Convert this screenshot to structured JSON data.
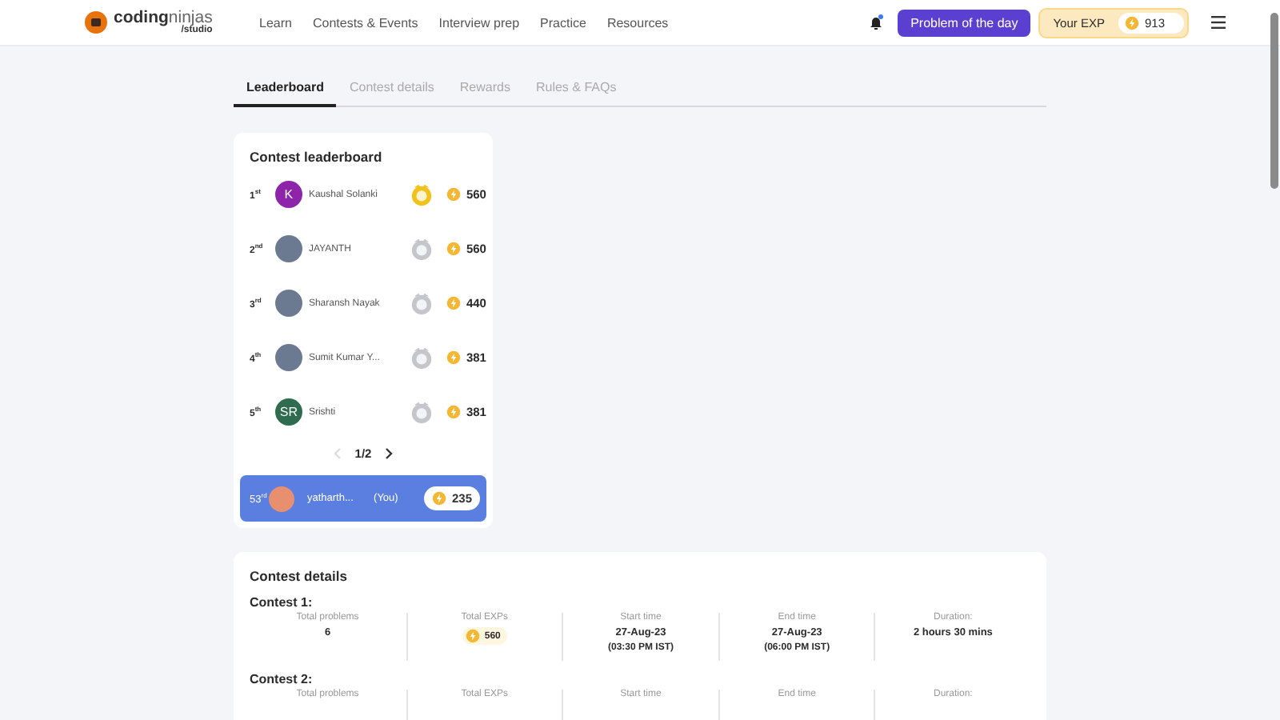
{
  "header": {
    "logo": {
      "wordmark": "**coding**ninjas",
      "sub": "/studio"
    },
    "nav": [
      "Learn",
      "Contests & Events",
      "Interview prep",
      "Practice",
      "Resources"
    ],
    "notification_dot": true,
    "potd_button": "Problem of the day",
    "exp": {
      "label": "Your EXP",
      "value": "913"
    }
  },
  "tabs": [
    {
      "label": "Leaderboard",
      "selected": true
    },
    {
      "label": "Contest details",
      "selected": false
    },
    {
      "label": "Rewards",
      "selected": false
    },
    {
      "label": "Rules & FAQs",
      "selected": false
    }
  ],
  "leaderboard": {
    "title": "Contest leaderboard",
    "rows": [
      {
        "rank": "1$^{st}$",
        "avatar": {
          "kind": "letter",
          "text": "K",
          "color": "#8e24aa"
        },
        "name": "Kaushal Solanki",
        "kind": "gold",
        "exp": "560"
      },
      {
        "rank": "2$^{nd}$",
        "avatar": {
          "kind": "photo"
        },
        "name": "JAYANTH",
        "kind": "silver",
        "exp": "560"
      },
      {
        "rank": "3$^{rd}$",
        "avatar": {
          "kind": "photo"
        },
        "name": "Sharansh Nayak",
        "kind": "silver",
        "exp": "440"
      },
      {
        "rank": "4$^{th}$",
        "avatar": {
          "kind": "photo"
        },
        "name": "Sumit Kumar Y...",
        "kind": "silver",
        "exp": "381"
      },
      {
        "rank": "5$^{th}$",
        "avatar": {
          "kind": "letter",
          "text": "SR",
          "color": "#2e6b4f"
        },
        "name": "Srishti",
        "kind": "silver",
        "exp": "381"
      }
    ],
    "pager": {
      "prev_disabled": true,
      "page": "1/2",
      "next_disabled": false
    },
    "me": {
      "rank": "53$^{rd}$",
      "name": "yatharth...",
      "you": "(You)",
      "exp": "235"
    }
  },
  "contest_details": {
    "title": "Contest details",
    "contests": [
      {
        "title": "Contest 1:",
        "fields": [
          {
            "kind": "text",
            "label": "Total problems",
            "value": "6"
          },
          {
            "kind": "exp",
            "label": "Total EXPs",
            "value": "560"
          },
          {
            "kind": "text",
            "label": "Start time",
            "value": "27-Aug-23",
            "sub": "(03:30 PM IST)"
          },
          {
            "kind": "text",
            "label": "End time",
            "value": "27-Aug-23",
            "sub": "(06:00 PM IST)"
          },
          {
            "kind": "text",
            "label": "Duration:",
            "value": "2 hours 30 mins"
          }
        ]
      },
      {
        "title": "Contest 2:",
        "fields": [
          {
            "kind": "text",
            "label": "Total problems"
          },
          {
            "kind": "text",
            "label": "Total EXPs"
          },
          {
            "kind": "text",
            "label": "Start time"
          },
          {
            "kind": "text",
            "label": "End time"
          },
          {
            "kind": "text",
            "label": "Duration:"
          }
        ]
      }
    ]
  }
}
